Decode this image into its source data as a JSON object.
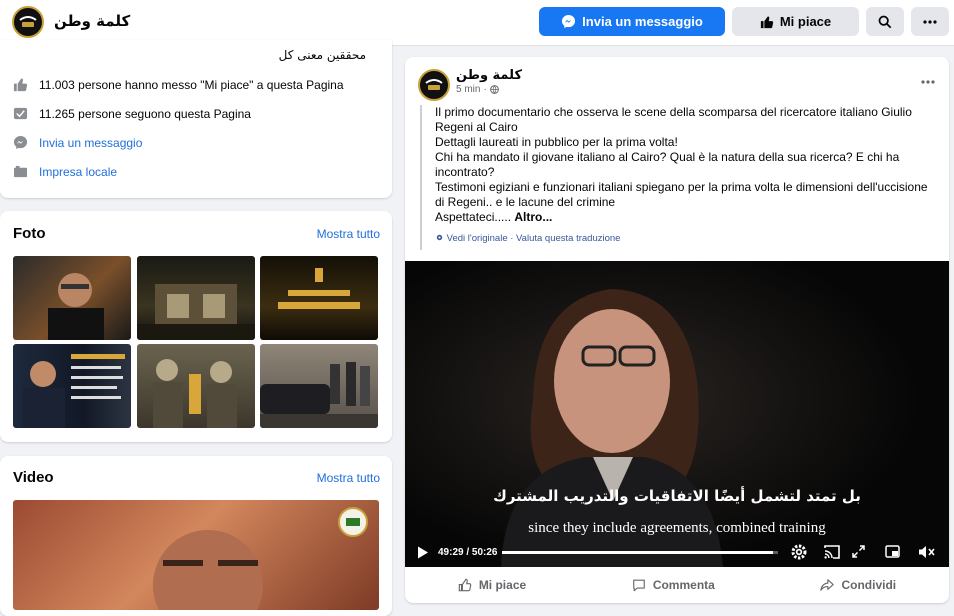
{
  "header": {
    "page_name": "كلمة وطن",
    "message_button": "Invia un messaggio",
    "like_button": "Mi piace",
    "search_icon": "search-icon",
    "more_icon": "more-icon"
  },
  "intro": {
    "cut_text": "محققين معنى كل",
    "likes": "11.003 persone hanno messo \"Mi piace\" a questa Pagina",
    "followers": "11.265 persone seguono questa Pagina",
    "send_message": "Invia un messaggio",
    "category": "Impresa locale"
  },
  "photos": {
    "title": "Foto",
    "see_all": "Mostra tutto"
  },
  "videos": {
    "title": "Video",
    "see_all": "Mostra tutto"
  },
  "post": {
    "author": "كلمة وطن",
    "time": "5 min",
    "privacy_icon": "globe-icon",
    "lines": [
      "Il primo documentario che osserva le scene della scomparsa del ricercatore italiano Giulio Regeni al Cairo",
      "Dettagli laureati in pubblico per la prima volta!",
      "Chi ha mandato il giovane italiano al Cairo? Qual è la natura della sua ricerca? E chi ha incontrato?",
      "Testimoni egiziani e funzionari italiani spiegano per la prima volta le dimensioni dell'uccisione di Regeni.. e le lacune del crimine",
      "Aspettateci..... "
    ],
    "more": "Altro...",
    "translation": "Vedi l'originale · Valuta questa traduzione",
    "video": {
      "subtitle_ar": "بل تمتد لتشمل أيضًا الاتفاقيات والتدريب المشترك",
      "subtitle_en": "since they include agreements, combined training",
      "time_display": "49:29 / 50:26",
      "progress": 0.981
    },
    "actions": {
      "like": "Mi piace",
      "comment": "Commenta",
      "share": "Condividi"
    }
  },
  "colors": {
    "accent": "#1877f2",
    "link": "#216fdb",
    "background": "#f0f2f5"
  }
}
